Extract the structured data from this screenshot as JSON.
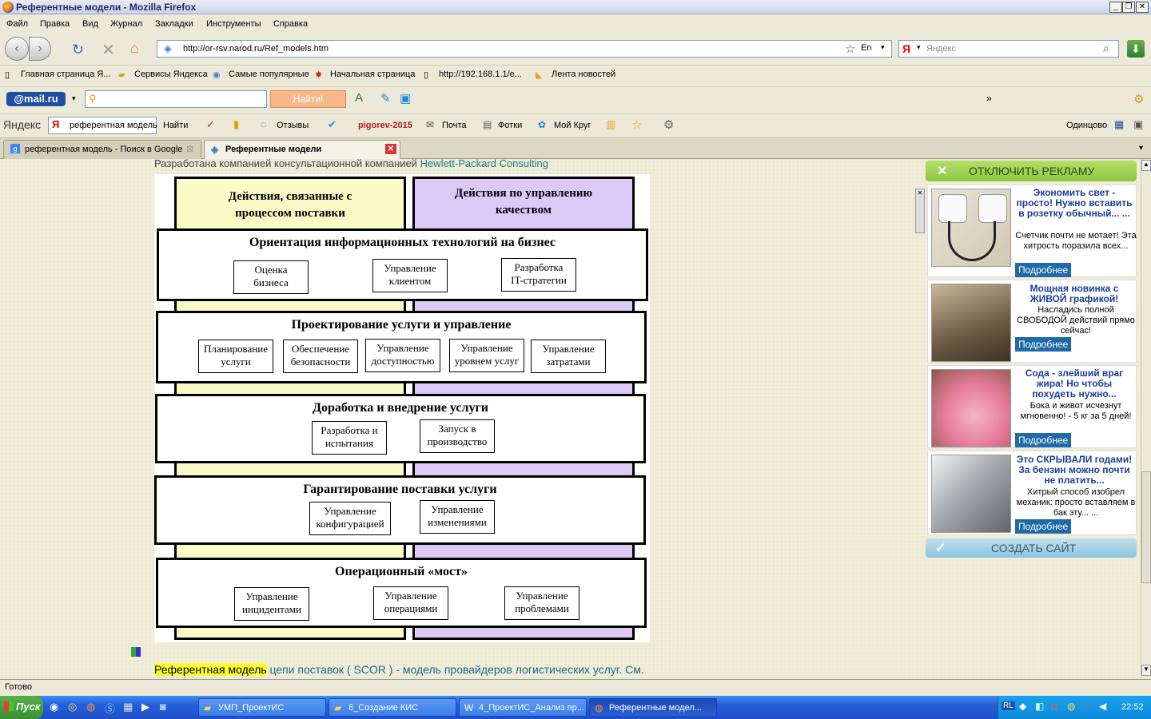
{
  "window": {
    "title": "Референтные модели - Mozilla Firefox"
  },
  "menu": [
    "Файл",
    "Правка",
    "Вид",
    "Журнал",
    "Закладки",
    "Инструменты",
    "Справка"
  ],
  "nav": {
    "url": "http://or-rsv.narod.ru/Ref_models.htm",
    "search_placeholder": "Яндекс",
    "lang": "En"
  },
  "bookmarks": [
    "Главная страница Я...",
    "Сервисы Яндекса",
    "Самые популярные",
    "Начальная страница",
    "http://192.168.1.1/e...",
    "Лента новостей"
  ],
  "mailbar": {
    "logo": "@mail.ru",
    "find_label": "Найти!"
  },
  "yabar": {
    "logo": "Яндекс",
    "query": "референтная модель",
    "find": "Найти",
    "reviews": "Отзывы",
    "user": "pigorev-2015",
    "mail": "Почта",
    "photos": "Фотки",
    "circle": "Мой Круг",
    "city": "Одинцово"
  },
  "tabs": [
    {
      "label": "референтная модель - Поиск в Google"
    },
    {
      "label": "Референтные модели"
    }
  ],
  "page": {
    "intro_prefix": "Разработана компанией консультационной компанией ",
    "intro_link": "Hewlett-Packard Consulting",
    "bottom_highlight": "Референтная модель",
    "bottom_rest": " цепи поставок ( SCOR ) - модель провайдеров логистических услуг. См."
  },
  "diagram": {
    "col_left": "Действия, связанные с\nпроцессом поставки",
    "col_right": "Действия по управлению\nкачеством",
    "bands": [
      {
        "title": "Ориентация информационных технологий на бизнес",
        "boxes": [
          "Оценка\nбизнеса",
          "Управление\nклиентом",
          "Разработка\nIT-стратегии"
        ]
      },
      {
        "title": "Проектирование услуги и управление",
        "boxes": [
          "Планирование\nуслуги",
          "Обеспечение\nбезопасности",
          "Управление\nдоступностью",
          "Управление\nуровнем услуг",
          "Управление\nзатратами"
        ]
      },
      {
        "title": "Доработка и внедрение услуги",
        "boxes": [
          "Разработка и\nиспытания",
          "Запуск в\nпроизводство"
        ]
      },
      {
        "title": "Гарантирование поставки услуги",
        "boxes": [
          "Управление\nконфигурацией",
          "Управление\nизменениями"
        ]
      },
      {
        "title": "Операционный «мост»",
        "boxes": [
          "Управление\nинцидентами",
          "Управление\nоперациями",
          "Управление\nпроблемами"
        ]
      }
    ]
  },
  "ads": {
    "disable": "ОТКЛЮЧИТЬ РЕКЛАМУ",
    "create": "СОЗДАТЬ САЙТ",
    "more": "Подробнее",
    "items": [
      {
        "title": "Экономить свет - просто! Нужно вставить в розетку обычный... ...",
        "text": "Счетчик почти не мотает! Эта хитрость поразила всех..."
      },
      {
        "title": "Мощная новинка с ЖИВОЙ графикой!",
        "text": "Насладись полной СВОБОДОЙ действий прямо сейчас!"
      },
      {
        "title": "Сода - злейший враг жира! Но чтобы похудеть нужно...",
        "text": "Бока и живот исчезнут мгновенно! - 5 кг за 5 дней!"
      },
      {
        "title": "Это СКРЫВАЛИ годами! За бензин можно почти не платить...",
        "text": "Хитрый способ изобрел механик: просто вставляем в бак эту... ..."
      }
    ]
  },
  "status": "Готово",
  "taskbar": {
    "start": "Пуск",
    "items": [
      "УМП_ПроектИС",
      "8_Создание КИС",
      "4_ПроектИС_Анализ пр...",
      "Референтные модел..."
    ],
    "lang": "RL",
    "time": "22:52"
  }
}
